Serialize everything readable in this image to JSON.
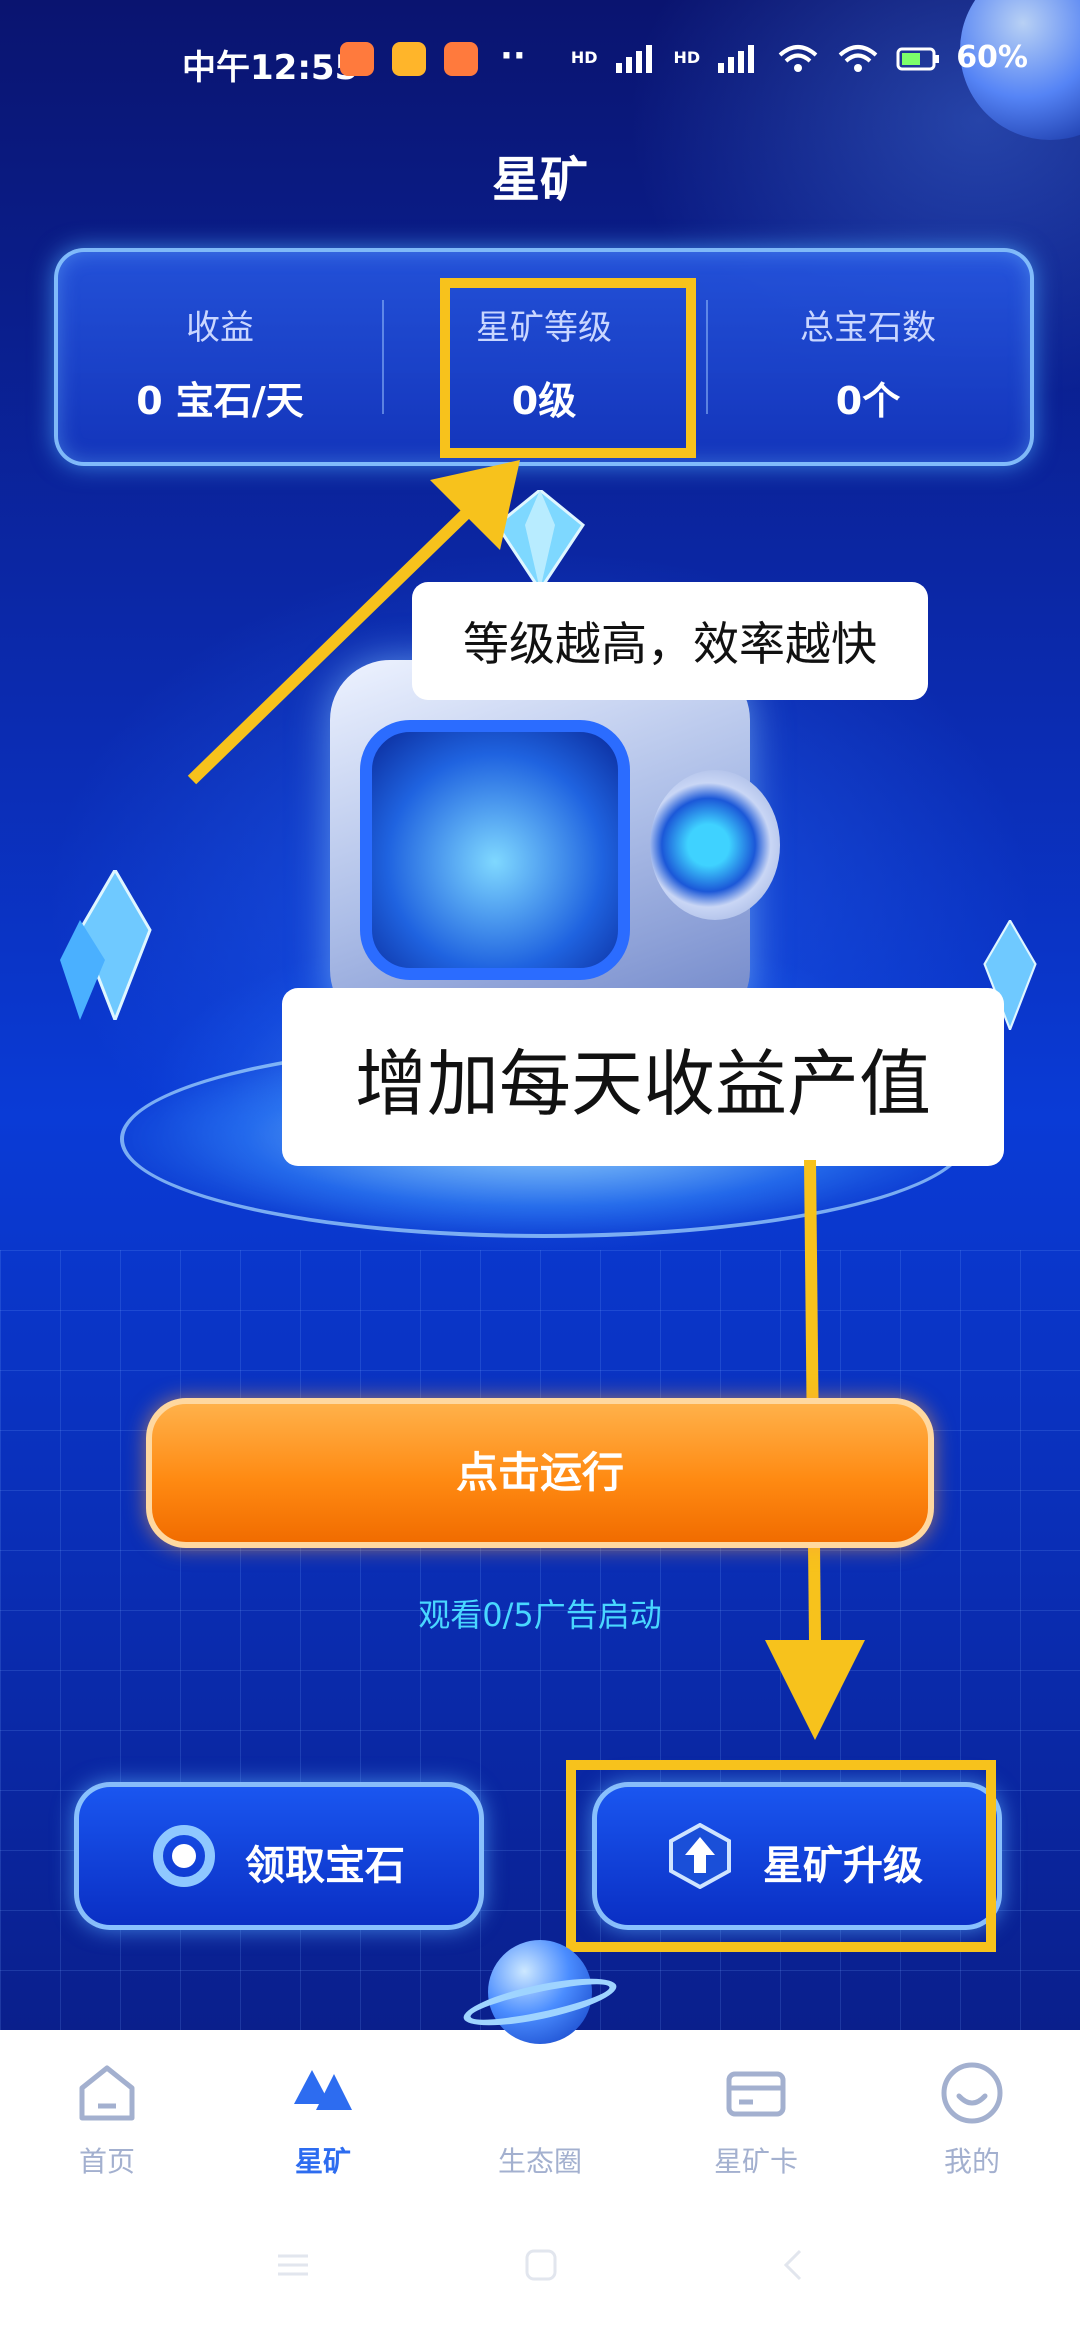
{
  "status_bar": {
    "time": "中午12:55",
    "battery": "60%",
    "signal_1": "HD",
    "signal_2": "HD",
    "notification_icons": [
      "mi-app-icon",
      "message-icon",
      "mi-app-icon"
    ],
    "more": "··"
  },
  "header": {
    "title": "星矿"
  },
  "stats": [
    {
      "label": "收益",
      "value": "0 宝石/天"
    },
    {
      "label": "星矿等级",
      "value": "0级"
    },
    {
      "label": "总宝石数",
      "value": "0个"
    }
  ],
  "annotations": {
    "level_note": "等级越高，效率越快",
    "income_note": "增加每天收益产值",
    "highlight_color": "#f7c21c"
  },
  "run_button": {
    "label": "点击运行"
  },
  "ad_hint": "观看0/5广告启动",
  "actions": {
    "claim": {
      "label": "领取宝石",
      "icon": "gem-ring-icon"
    },
    "upgrade": {
      "label": "星矿升级",
      "icon": "upgrade-arrow-icon"
    }
  },
  "bottom_nav": [
    {
      "label": "首页",
      "icon": "home-icon",
      "active": false
    },
    {
      "label": "星矿",
      "icon": "mountain-icon",
      "active": true
    },
    {
      "label": "生态圈",
      "icon": "planet-icon",
      "active": false
    },
    {
      "label": "星矿卡",
      "icon": "card-icon",
      "active": false
    },
    {
      "label": "我的",
      "icon": "smile-profile-icon",
      "active": false
    }
  ],
  "colors": {
    "accent": "#2d6cf0",
    "run_orange": "#ff8a12",
    "ad_hint": "#49d7ff"
  }
}
